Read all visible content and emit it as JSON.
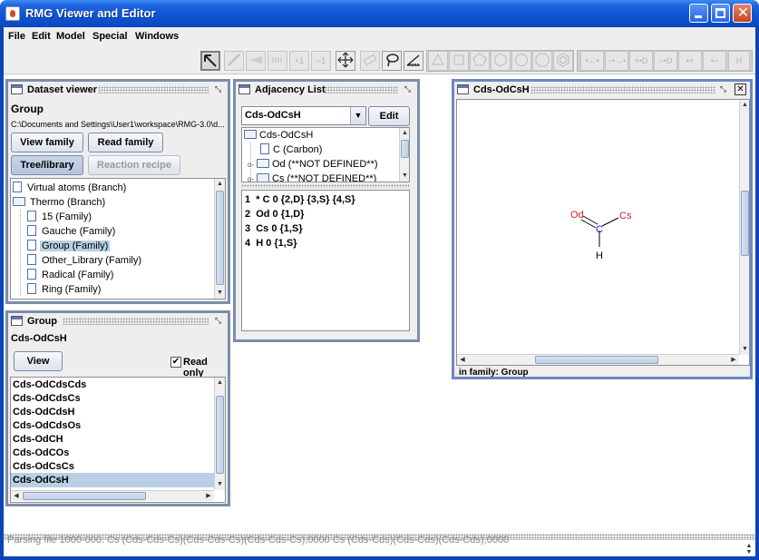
{
  "window": {
    "title": "RMG Viewer and Editor"
  },
  "menu": [
    "File",
    "Edit",
    "Model",
    "Special",
    "Windows"
  ],
  "dataset_viewer": {
    "title": "Dataset viewer",
    "heading": "Group",
    "path": "C:\\Documents and Settings\\User1\\workspace\\RMG-3.0\\d...",
    "buttons": {
      "view_family": "View family",
      "read_family": "Read family",
      "tree_library": "Tree/library",
      "reaction_recipe": "Reaction recipe"
    },
    "tree": [
      {
        "label": "Virtual atoms (Branch)",
        "kind": "file",
        "level": 0
      },
      {
        "label": "Thermo (Branch)",
        "kind": "folder",
        "level": 0
      },
      {
        "label": "15 (Family)",
        "kind": "file",
        "level": 1
      },
      {
        "label": "Gauche (Family)",
        "kind": "file",
        "level": 1
      },
      {
        "label": "Group (Family)",
        "kind": "file",
        "level": 1,
        "selected": true
      },
      {
        "label": "Other_Library (Family)",
        "kind": "file",
        "level": 1
      },
      {
        "label": "Radical (Family)",
        "kind": "file",
        "level": 1
      },
      {
        "label": "Ring (Family)",
        "kind": "file",
        "level": 1
      }
    ]
  },
  "group_panel": {
    "title": "Group",
    "heading": "Cds-OdCsH",
    "view_label": "View",
    "read_only_label": "Read only",
    "read_only_checked": true,
    "items": [
      "Cds-OdCdsCds",
      "Cds-OdCdsCs",
      "Cds-OdCdsH",
      "Cds-OdCdsOs",
      "Cds-OdCH",
      "Cds-OdCOs",
      "Cds-OdCsCs",
      "Cds-OdCsH"
    ],
    "selected_index": 7
  },
  "adjacency": {
    "title": "Adjacency List",
    "combo_value": "Cds-OdCsH",
    "edit_label": "Edit",
    "tree": [
      {
        "label": "Cds-OdCsH",
        "kind": "folder",
        "level": 0
      },
      {
        "label": "C (Carbon)",
        "kind": "file",
        "level": 1
      },
      {
        "label": "Od (**NOT DEFINED**)",
        "kind": "folder-key",
        "level": 1
      },
      {
        "label": "Cs (**NOT DEFINED**)",
        "kind": "folder-key",
        "level": 1
      }
    ],
    "lines": [
      "1  * C 0 {2,D} {3,S} {4,S}",
      "2  Od 0 {1,D}",
      "3  Cs 0 {1,S}",
      "4  H 0 {1,S}"
    ]
  },
  "molecule_window": {
    "title": "Cds-OdCsH",
    "status": "in family: Group",
    "atoms": {
      "center": "C",
      "top_left": "Od",
      "top_right": "Cs",
      "bottom": "H"
    },
    "colors": {
      "carbon": "#1a1ad6",
      "oxygen": "#d42020",
      "hydrogen": "#000000"
    }
  },
  "status_log": "Parsing file 1000-000.           Cs (Cds-Cds-Cs)(Cds-Cds-Cs)(Cds-Cds-Cs),0000                    Cs (Cds-Cds)(Cds-Cds)(Cds-Cds),0000"
}
